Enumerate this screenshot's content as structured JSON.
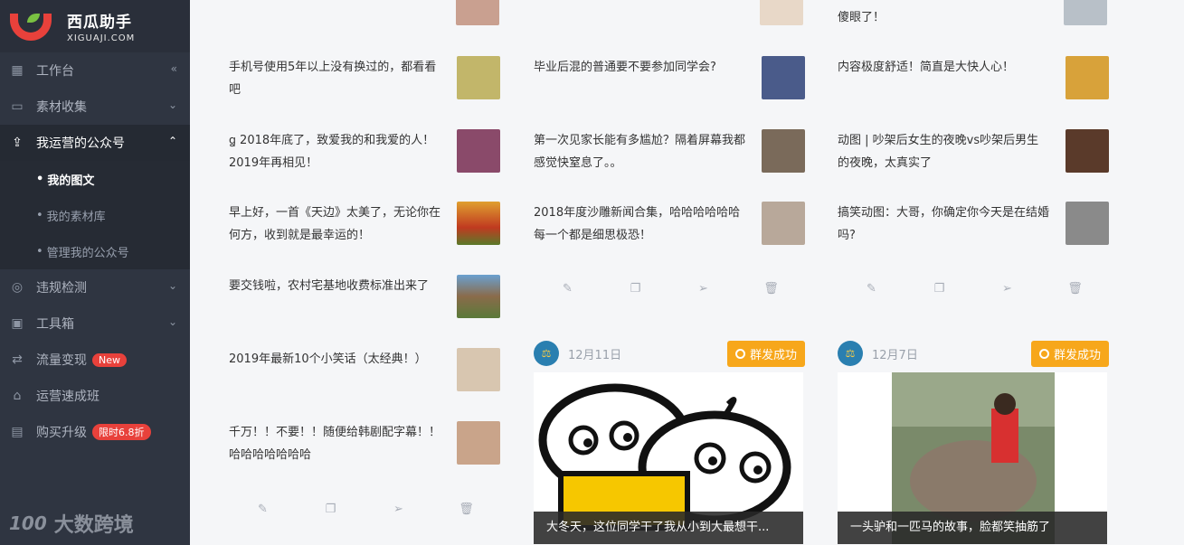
{
  "brand": {
    "name": "西瓜助手",
    "sub": "XIGUAJI.COM"
  },
  "sidebar": {
    "items": [
      {
        "label": "工作台",
        "icon": "dashboard-icon",
        "chevron": "«"
      },
      {
        "label": "素材收集",
        "icon": "inbox-icon",
        "chevron": "⌄"
      },
      {
        "label": "我运营的公众号",
        "icon": "upload-icon",
        "chevron": "⌃"
      },
      {
        "label": "违规检测",
        "icon": "scan-icon",
        "chevron": "⌄"
      },
      {
        "label": "工具箱",
        "icon": "briefcase-icon",
        "chevron": "⌄"
      },
      {
        "label": "流量变现",
        "icon": "exchange-icon",
        "badge": "New"
      },
      {
        "label": "运营速成班",
        "icon": "graduation-icon"
      },
      {
        "label": "购买升级",
        "icon": "card-icon",
        "badge": "限时6.8折"
      }
    ],
    "sub_items": [
      {
        "label": "我的图文"
      },
      {
        "label": "我的素材库"
      },
      {
        "label": "管理我的公众号"
      }
    ]
  },
  "watermark": {
    "logo": "100",
    "text": "大数跨境"
  },
  "columns": [
    {
      "articles": [
        {
          "title": "手机号使用5年以上没有换过的，都看看吧",
          "thumb_color": "#c2b66a"
        },
        {
          "title": "ꬶ 2018年底了，致爱我的和我爱的人！2019年再相见！",
          "thumb_color": "#8a4a6a"
        },
        {
          "title": "早上好，一首《天边》太美了，无论你在何方，收到就是最幸运的！",
          "thumb_color": "#d96a2a"
        },
        {
          "title": "要交钱啦，农村宅基地收费标准出来了",
          "thumb_color": "#8a6b4a"
        },
        {
          "title": "2019年最新10个小笑话（太经典！）",
          "thumb_color": "#d8c6b0"
        },
        {
          "title": "千万！！不要！！随便给韩剧配字幕！！哈哈哈哈哈哈哈",
          "thumb_color": "#c9a48a"
        }
      ]
    },
    {
      "articles": [
        {
          "title": "毕业后混的普通要不要参加同学会?",
          "thumb_color": "#4a5b8a"
        },
        {
          "title": "第一次见家长能有多尴尬？隔着屏幕我都感觉快窒息了。。",
          "thumb_color": "#7a6a5a"
        },
        {
          "title": "2018年度沙雕新闻合集，哈哈哈哈哈哈每一个都是细思极恐！",
          "thumb_color": "#b8a89a"
        }
      ],
      "post": {
        "date": "12月11日",
        "status": "群发成功",
        "caption": "大冬天，这位同学干了我从小到大最想干..."
      }
    },
    {
      "top_partial": "傻眼了！",
      "articles": [
        {
          "title": "内容极度舒适！简直是大快人心！",
          "thumb_color": "#d8a23a"
        },
        {
          "title": "动图 | 吵架后女生的夜晚vs吵架后男生的夜晚，太真实了",
          "thumb_color": "#5a3a2a"
        },
        {
          "title": "搞笑动图：大哥，你确定你今天是在结婚吗?",
          "thumb_color": "#8a8a8a"
        }
      ],
      "post": {
        "date": "12月7日",
        "status": "群发成功",
        "caption": "一头驴和一匹马的故事，脸都笑抽筋了"
      }
    }
  ]
}
